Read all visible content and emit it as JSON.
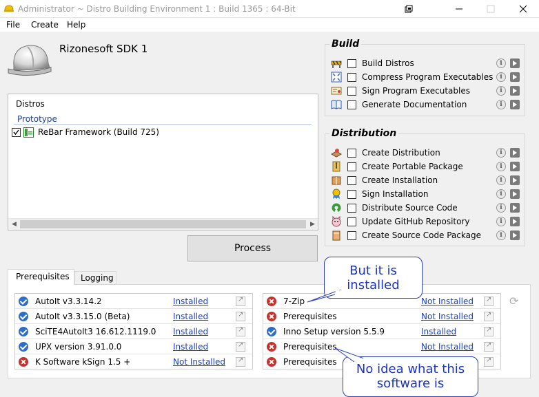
{
  "window": {
    "title": "Administrator ~ Distro Building Environment 1 : Build 1365 : 64-Bit"
  },
  "menu": [
    "File",
    "Create",
    "Help"
  ],
  "header": {
    "sdk_name": "Rizonesoft SDK 1"
  },
  "distros": {
    "header": "Distros",
    "group": "Prototype",
    "items": [
      {
        "label": "ReBar Framework (Build 725)",
        "checked": true
      }
    ]
  },
  "process_label": "Process",
  "build": {
    "title": "Build",
    "tasks": [
      {
        "label": "Build Distros",
        "icon": "construction-icon"
      },
      {
        "label": "Compress Program Executables",
        "icon": "compress-icon"
      },
      {
        "label": "Sign Program Executables",
        "icon": "certificate-icon"
      },
      {
        "label": "Generate Documentation",
        "icon": "book-icon"
      }
    ]
  },
  "distribution": {
    "title": "Distribution",
    "tasks": [
      {
        "label": "Create Distribution",
        "icon": "package-icon"
      },
      {
        "label": "Create Portable Package",
        "icon": "zip-icon"
      },
      {
        "label": "Create Installation",
        "icon": "box-icon"
      },
      {
        "label": "Sign Installation",
        "icon": "award-icon"
      },
      {
        "label": "Distribute Source Code",
        "icon": "open-source-icon"
      },
      {
        "label": "Update GitHub Repository",
        "icon": "github-icon"
      },
      {
        "label": "Create Source Code Package",
        "icon": "source-package-icon"
      }
    ]
  },
  "tabs": {
    "prerequisites": "Prerequisites",
    "logging": "Logging"
  },
  "prereqs_left": [
    {
      "name": "AutoIt v3.3.14.2",
      "status": "Installed",
      "ok": true
    },
    {
      "name": "AutoIt v3.3.15.0 (Beta)",
      "status": "Installed",
      "ok": true
    },
    {
      "name": "SciTE4AutoIt3 16.612.1119.0",
      "status": "Installed",
      "ok": true
    },
    {
      "name": "UPX version 3.91.0.0",
      "status": "Installed",
      "ok": true
    },
    {
      "name": "K Software kSign 1.5 +",
      "status": "Not Installed",
      "ok": false
    }
  ],
  "prereqs_right": [
    {
      "name": "7-Zip",
      "status": "Not Installed",
      "ok": false
    },
    {
      "name": "Prerequisites",
      "status": "Not Installed",
      "ok": false
    },
    {
      "name": "Inno Setup version 5.5.9",
      "status": "Installed",
      "ok": true
    },
    {
      "name": "Prerequisites",
      "status": "Not Installed",
      "ok": false
    },
    {
      "name": "Prerequisites",
      "status": "",
      "ok": false
    }
  ],
  "callouts": {
    "installed": [
      "But it is",
      "installed"
    ],
    "no_idea": [
      "No idea what this",
      "software is"
    ]
  },
  "colors": {
    "accent": "#1a3fbf",
    "ok": "#2d6fc8",
    "error": "#c8312b",
    "callout": "#1a33c4"
  }
}
